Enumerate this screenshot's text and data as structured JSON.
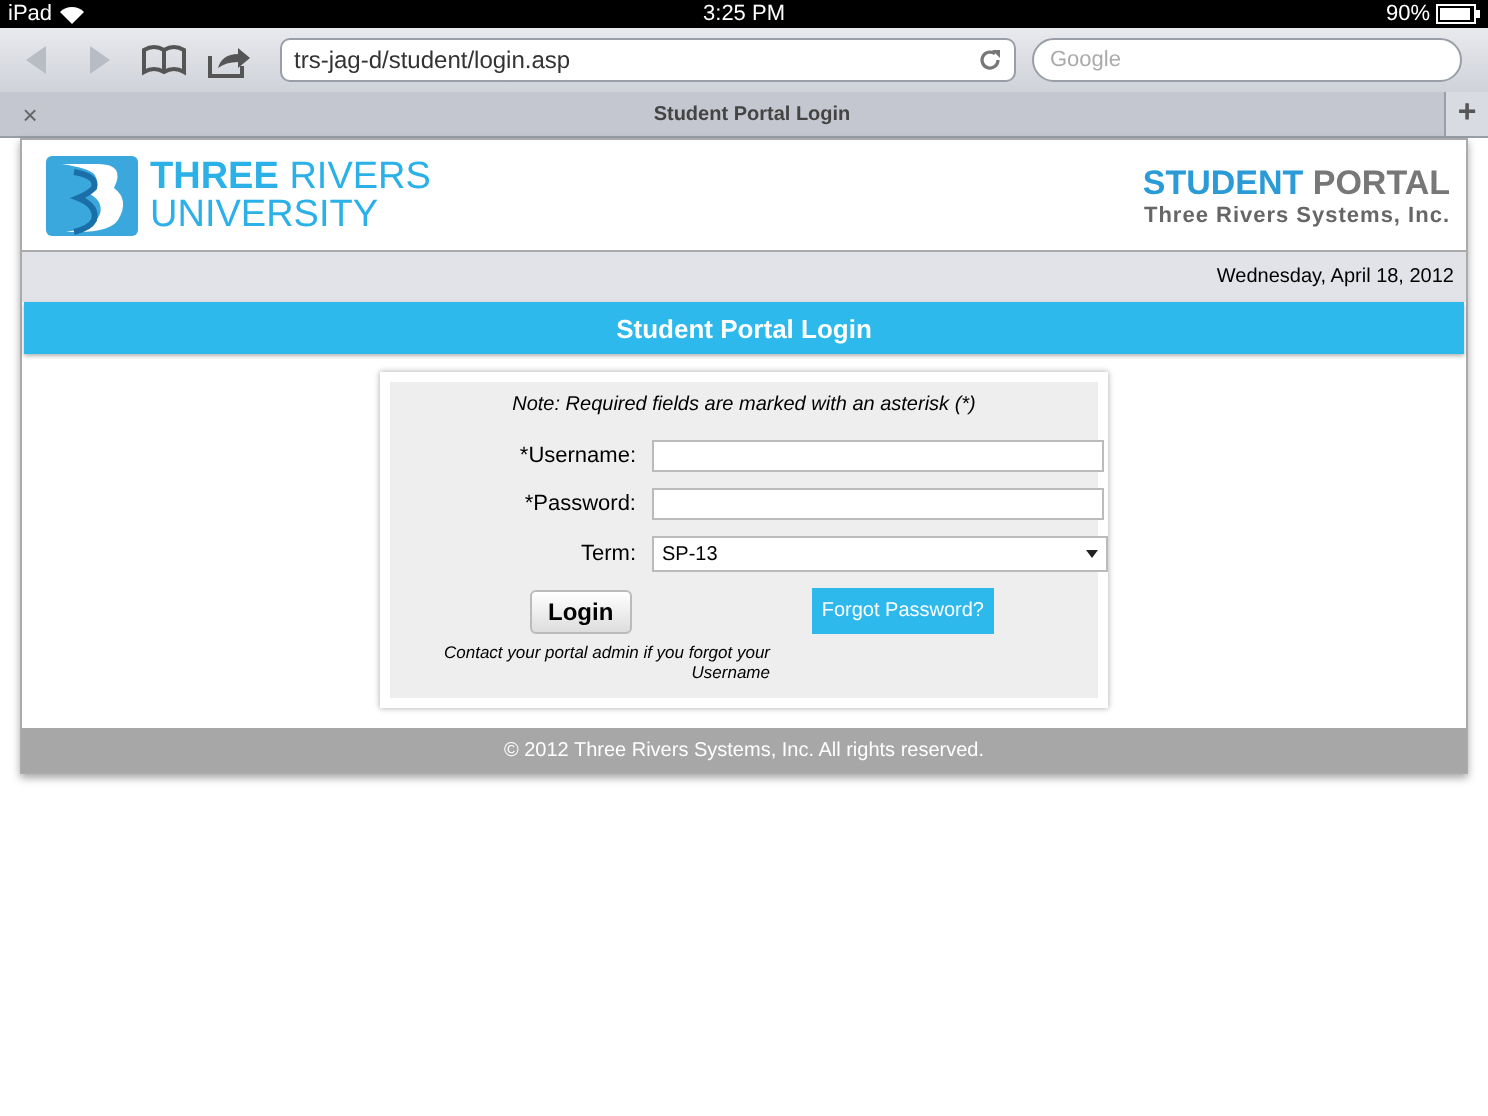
{
  "status_bar": {
    "device": "iPad",
    "time": "3:25 PM",
    "battery": "90%"
  },
  "browser": {
    "url": "trs-jag-d/student/login.asp",
    "search": {
      "placeholder": "Google"
    },
    "tab_title": "Student Portal Login",
    "close": "×",
    "new_tab": "+"
  },
  "header": {
    "logo_line1_bold": "THREE",
    "logo_line1_rest": "RIVERS",
    "logo_line2": "UNIVERSITY",
    "portal_bold": "STUDENT",
    "portal_rest": "PORTAL",
    "company": "Three Rivers Systems, Inc."
  },
  "date": "Wednesday, April 18, 2012",
  "banner": "Student Portal Login",
  "form": {
    "note": "Note: Required fields are marked with an asterisk (*)",
    "fields": [
      {
        "label": "*Username:",
        "kind": "text"
      },
      {
        "label": "*Password:",
        "kind": "password"
      },
      {
        "label": "Term:",
        "kind": "select",
        "value": "SP-13"
      }
    ],
    "login_button": "Login",
    "forgot_button": "Forgot Password?",
    "help": "Contact your portal admin if you forgot your Username"
  },
  "footer": "© 2012 Three Rivers Systems, Inc. All rights reserved."
}
